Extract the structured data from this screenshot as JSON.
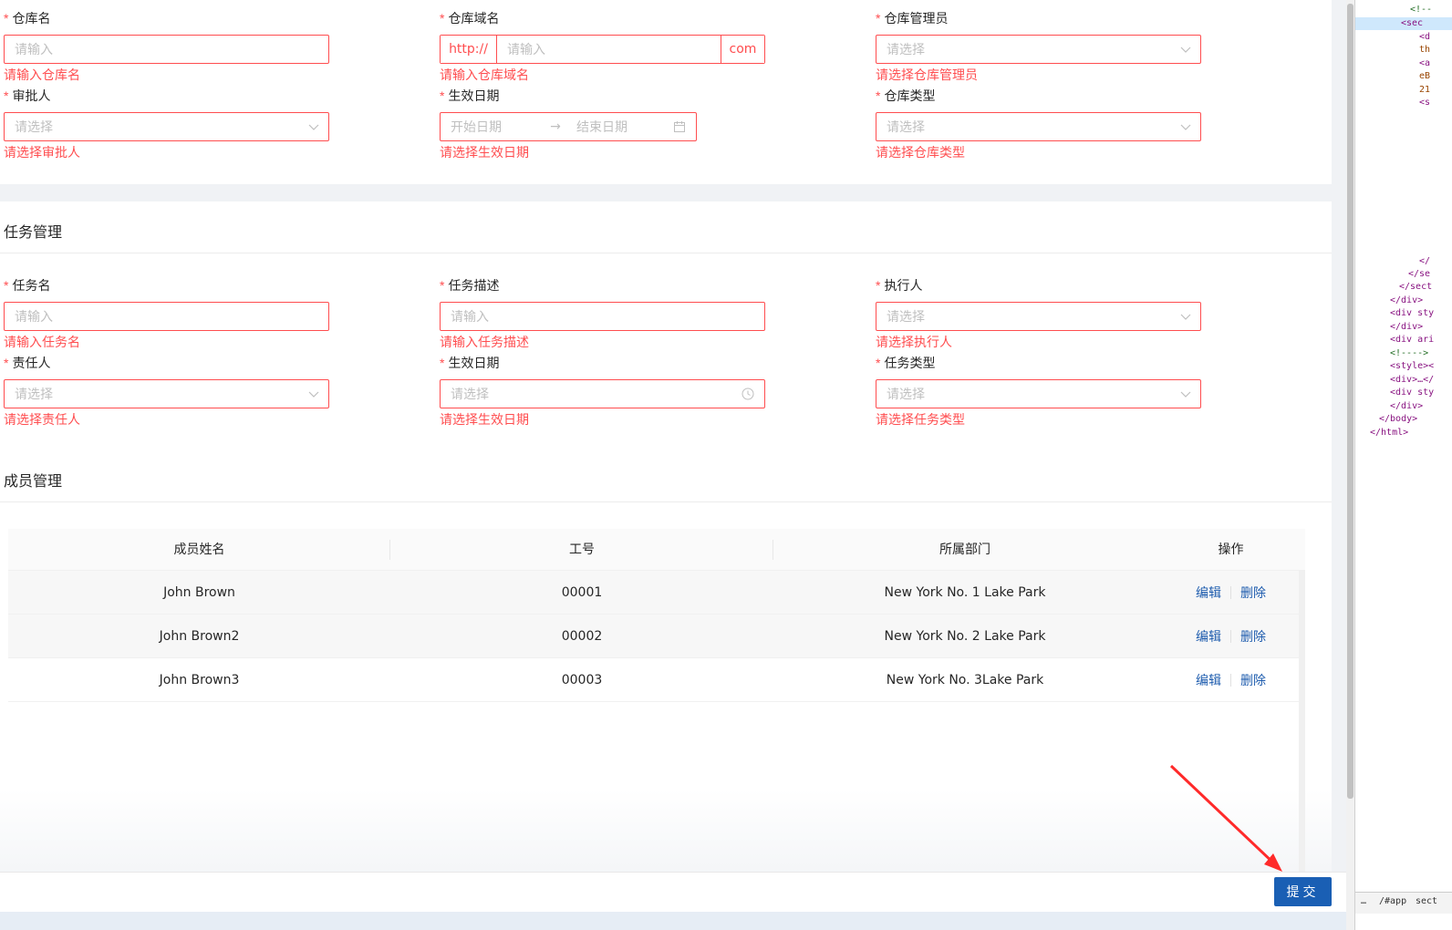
{
  "warehouse": {
    "fields": [
      {
        "label": "仓库名",
        "placeholder": "请输入",
        "error": "请输入仓库名"
      },
      {
        "label": "仓库域名",
        "prefix": "http://",
        "placeholder": "请输入",
        "suffix": "com",
        "error": "请输入仓库域名"
      },
      {
        "label": "仓库管理员",
        "placeholder": "请选择",
        "error": "请选择仓库管理员"
      },
      {
        "label": "审批人",
        "placeholder": "请选择",
        "error": "请选择审批人"
      },
      {
        "label": "生效日期",
        "start_placeholder": "开始日期",
        "end_placeholder": "结束日期",
        "error": "请选择生效日期"
      },
      {
        "label": "仓库类型",
        "placeholder": "请选择",
        "error": "请选择仓库类型"
      }
    ]
  },
  "task": {
    "title": "任务管理",
    "fields": [
      {
        "label": "任务名",
        "placeholder": "请输入",
        "error": "请输入任务名"
      },
      {
        "label": "任务描述",
        "placeholder": "请输入",
        "error": "请输入任务描述"
      },
      {
        "label": "执行人",
        "placeholder": "请选择",
        "error": "请选择执行人"
      },
      {
        "label": "责任人",
        "placeholder": "请选择",
        "error": "请选择责任人"
      },
      {
        "label": "生效日期",
        "placeholder": "请选择",
        "error": "请选择生效日期"
      },
      {
        "label": "任务类型",
        "placeholder": "请选择",
        "error": "请选择任务类型"
      }
    ]
  },
  "members": {
    "title": "成员管理",
    "columns": [
      "成员姓名",
      "工号",
      "所属部门",
      "操作"
    ],
    "rows": [
      {
        "name": "John Brown",
        "id": "00001",
        "dept": "New York No. 1 Lake Park"
      },
      {
        "name": "John Brown2",
        "id": "00002",
        "dept": "New York No. 2 Lake Park"
      },
      {
        "name": "John Brown3",
        "id": "00003",
        "dept": "New York No. 3Lake Park"
      }
    ],
    "edit_label": "编辑",
    "delete_label": "删除"
  },
  "required_mark": "*",
  "submit_label": "提交",
  "devtools": {
    "lines": [
      "<!--",
      "<sec",
      "<d",
      "th",
      "<a",
      "eB",
      "21",
      "<s",
      "</",
      "</se",
      "</sect",
      "</div>",
      "<div sty",
      "</div>",
      "<div ari",
      "<!---->",
      "<style><",
      "<div>…</",
      "<div sty",
      "</div>",
      "</body>",
      "</html>"
    ],
    "footer": [
      "…",
      "/#app",
      "sect"
    ]
  },
  "colors": {
    "error": "#ff4d4f",
    "primary": "#1a5fb4",
    "link": "#1e5cae"
  }
}
